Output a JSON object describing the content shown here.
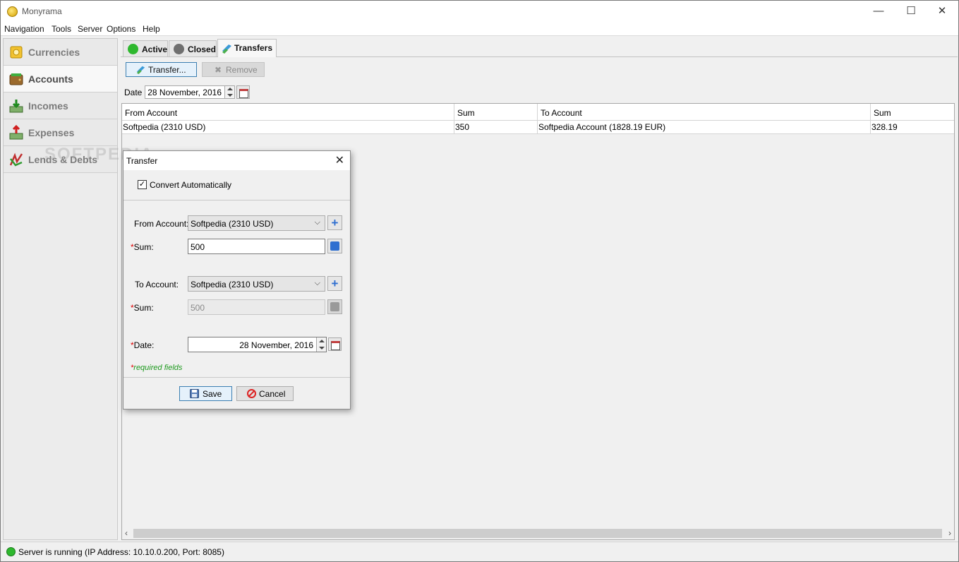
{
  "window": {
    "title": "Monyrama",
    "minimize_glyph": "—",
    "maximize_glyph": "☐",
    "close_glyph": "✕"
  },
  "menu": [
    "Navigation",
    "Tools",
    "Server",
    "Options",
    "Help"
  ],
  "sidebar": {
    "items": [
      {
        "label": "Currencies",
        "icon": "currency-icon",
        "active": false
      },
      {
        "label": "Accounts",
        "icon": "wallet-icon",
        "active": true
      },
      {
        "label": "Incomes",
        "icon": "income-icon",
        "active": false
      },
      {
        "label": "Expenses",
        "icon": "expense-icon",
        "active": false
      },
      {
        "label": "Lends & Debts",
        "icon": "lends-icon",
        "active": false
      }
    ]
  },
  "tabs": [
    {
      "label": "Active",
      "icon": "green-dot-icon"
    },
    {
      "label": "Closed",
      "icon": "gray-dot-icon"
    },
    {
      "label": "Transfers",
      "icon": "transfer-icon",
      "active": true
    }
  ],
  "toolbar": {
    "transfer_label": "Transfer...",
    "remove_label": "Remove"
  },
  "filter": {
    "date_label": "Date",
    "date_value": "28 November, 2016"
  },
  "table": {
    "headers": [
      "From Account",
      "Sum",
      "To Account",
      "Sum"
    ],
    "rows": [
      [
        "Softpedia (2310 USD)",
        "350",
        "Softpedia Account (1828.19 EUR)",
        "328.19"
      ]
    ]
  },
  "watermark": "SOFTPEDIA",
  "dialog": {
    "title": "Transfer",
    "close_glyph": "✕",
    "convert_label": "Convert Automatically",
    "convert_checked": true,
    "from_account_label": "From Account:",
    "from_account_value": "Softpedia (2310 USD)",
    "from_sum_label": "Sum:",
    "from_sum_value": "500",
    "to_account_label": "To Account:",
    "to_account_value": "Softpedia (2310 USD)",
    "to_sum_label": "Sum:",
    "to_sum_value": "500",
    "date_label": "Date:",
    "date_value": "28 November, 2016",
    "required_note": "required fields",
    "required_mark": "*",
    "save_label": "Save",
    "cancel_label": "Cancel",
    "add_glyph": "+",
    "dropdown_glyph": "⌵"
  },
  "status": {
    "text": "Server is running (IP Address: 10.10.0.200, Port: 8085)"
  },
  "colors": {
    "active_green": "#2eb82e",
    "accent_blue": "#2f6fd0",
    "required_red": "#dd0000",
    "note_green": "#1f9a1f"
  }
}
